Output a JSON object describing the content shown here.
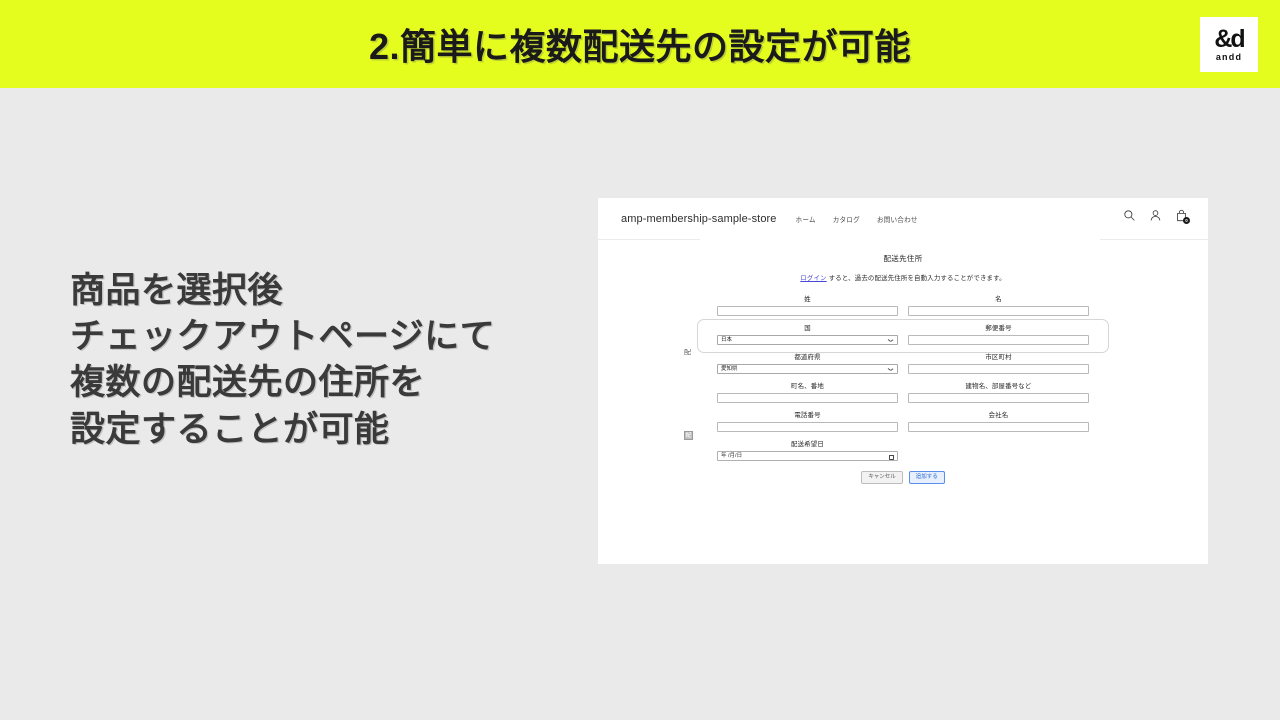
{
  "banner": {
    "title": "2.簡単に複数配送先の設定が可能",
    "bg_color": "#e4fc1e",
    "logo": {
      "mark": "&d",
      "word": "andd"
    }
  },
  "copy": {
    "lines": [
      "商品を選択後",
      "チェックアウトページにて",
      "複数の配送先の住所を",
      "設定することが可能"
    ]
  },
  "inset": {
    "store_header": {
      "store_name": "amp-membership-sample-store",
      "nav": [
        {
          "label": "ホーム"
        },
        {
          "label": "カタログ"
        },
        {
          "label": "お問い合わせ"
        }
      ],
      "icons": [
        {
          "name": "search-icon"
        },
        {
          "name": "account-icon"
        },
        {
          "name": "cart-icon"
        }
      ],
      "cart_count": "0"
    },
    "form": {
      "title": "配送先住所",
      "login_link": "ログイン",
      "login_note": "すると、過去の配送先住所を自動入力することができます。",
      "edge_stub_top": "配",
      "edge_stub_bottom": "配",
      "rows": [
        {
          "fields": [
            {
              "label": "姓",
              "type": "text",
              "value": "",
              "name": "last-name-field"
            },
            {
              "label": "名",
              "type": "text",
              "value": "",
              "name": "first-name-field"
            }
          ]
        },
        {
          "boxed": true,
          "fields": [
            {
              "label": "国",
              "type": "select",
              "value": "日本",
              "name": "country-select"
            },
            {
              "label": "郵便番号",
              "type": "text",
              "value": "",
              "name": "postal-code-field"
            }
          ]
        },
        {
          "fields": [
            {
              "label": "都道府県",
              "type": "select",
              "value": "愛知県",
              "name": "prefecture-select"
            },
            {
              "label": "市区町村",
              "type": "text",
              "value": "",
              "name": "city-field"
            }
          ]
        },
        {
          "fields": [
            {
              "label": "町名、番地",
              "type": "text",
              "value": "",
              "name": "address-line1-field"
            },
            {
              "label": "建物名、部屋番号など",
              "type": "text",
              "value": "",
              "name": "address-line2-field"
            }
          ]
        },
        {
          "fields": [
            {
              "label": "電話番号",
              "type": "text",
              "value": "",
              "name": "phone-field"
            },
            {
              "label": "会社名",
              "type": "text",
              "value": "",
              "name": "company-field"
            }
          ]
        }
      ],
      "date_field": {
        "label": "配送希望日",
        "value": "年 /月/日",
        "name": "delivery-date-field"
      },
      "buttons": {
        "cancel": "キャンセル",
        "submit": "追加する"
      }
    }
  },
  "colors": {
    "banner": "#e4fc1e",
    "page_bg": "#eaeaea",
    "copy_text": "#3a3a3a",
    "link": "#4a48d6",
    "primary_button": "#2b6cd4"
  }
}
